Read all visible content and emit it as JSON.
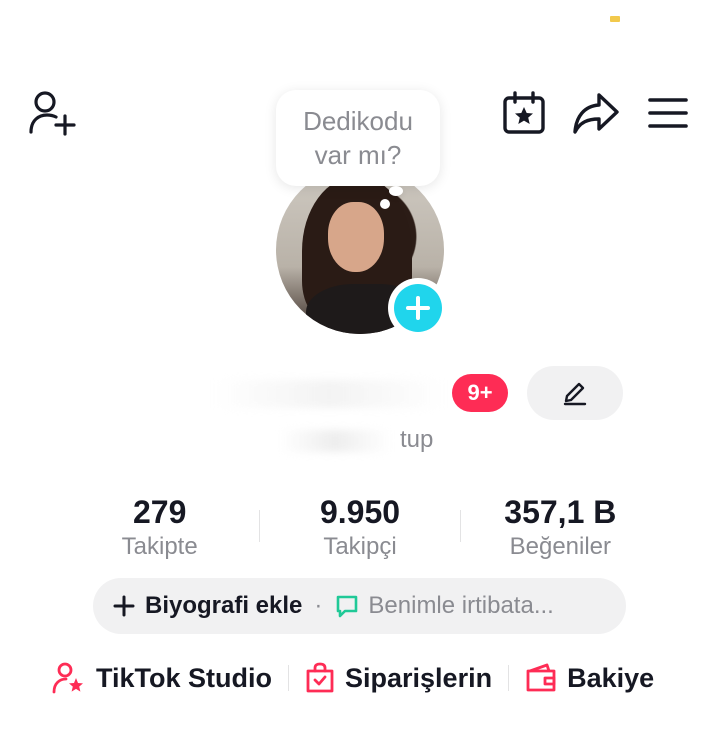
{
  "header": {
    "icons": {
      "add_user": "add-user-icon",
      "calendar": "calendar-star-icon",
      "share": "share-icon",
      "menu": "menu-icon"
    }
  },
  "profile": {
    "bubble_text_line1": "Dedikodu",
    "bubble_text_line2": "var mı?",
    "notification_badge": "9+",
    "handle_suffix": "tup",
    "edit_icon": "pencil-icon"
  },
  "stats": [
    {
      "value": "279",
      "label": "Takipte"
    },
    {
      "value": "9.950",
      "label": "Takipçi"
    },
    {
      "value": "357,1 B",
      "label": "Beğeniler"
    }
  ],
  "bio": {
    "add_label": "Biyografi ekle",
    "separator": "·",
    "contact_label": "Benimle irtibata..."
  },
  "shortcuts": [
    {
      "label": "TikTok Studio",
      "icon": "user-star-icon"
    },
    {
      "label": "Siparişlerin",
      "icon": "shopping-bag-icon"
    },
    {
      "label": "Bakiye",
      "icon": "wallet-icon"
    }
  ],
  "colors": {
    "accent_red": "#fe2c55",
    "accent_cyan": "#20d5ec",
    "contact_green": "#20c997"
  }
}
